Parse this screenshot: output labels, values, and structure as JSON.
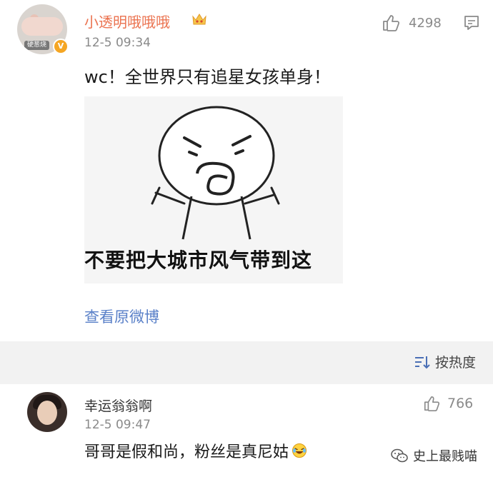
{
  "top_comment": {
    "username": "小透明哦哦哦",
    "avatar_tag": "硬葱烧",
    "verified_badge": "V",
    "timestamp": "12-5 09:34",
    "like_count": "4298",
    "text": "wc！全世界只有追星女孩单身！",
    "meme_caption": "不要把大城市风气带到这",
    "view_original_label": "查看原微博"
  },
  "sort": {
    "label": "按热度"
  },
  "reply_comment": {
    "username": "幸运翁翁啊",
    "timestamp": "12-5 09:47",
    "like_count": "766",
    "text": "哥哥是假和尚，粉丝是真尼姑"
  },
  "watermark": {
    "text": "史上最贱喵"
  },
  "colors": {
    "username_orange": "#eb7350",
    "link_blue": "#5a80c8",
    "meta_gray": "#8a8a8a",
    "band_gray": "#f2f2f2"
  },
  "icons": [
    "crown-icon",
    "thumbs-up-icon",
    "comment-icon",
    "sort-icon",
    "laugh-emoji-icon",
    "wechat-icon"
  ]
}
